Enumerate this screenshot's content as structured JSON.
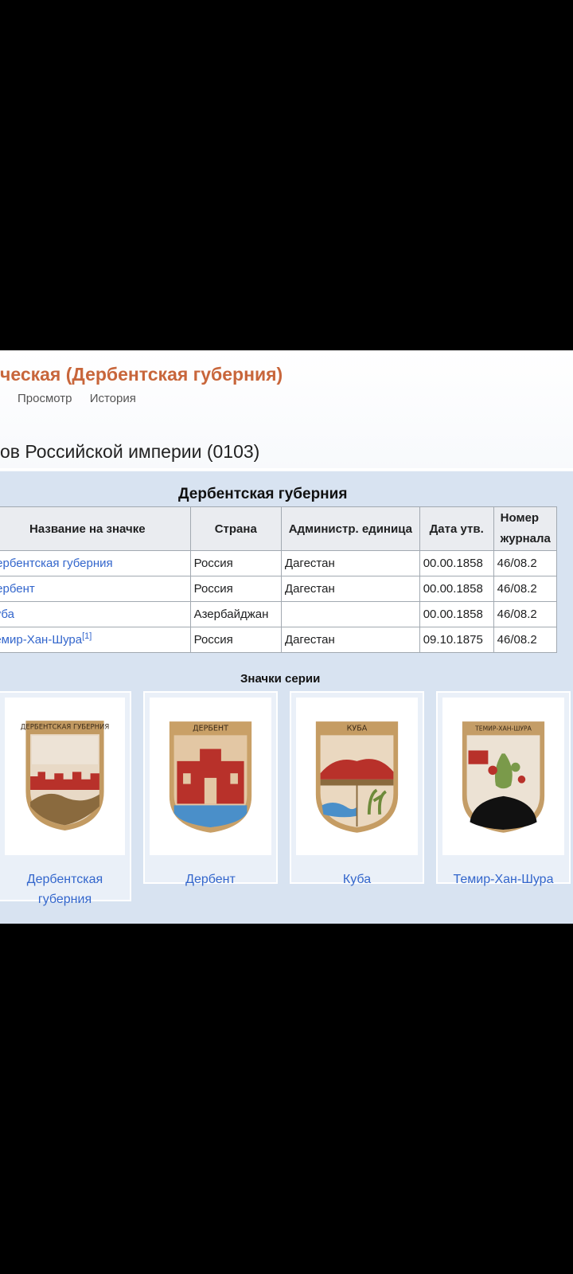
{
  "page": {
    "title": "ческая (Дербентская губерния)",
    "tabs": [
      "Просмотр",
      "История"
    ],
    "section_heading": "ов Российской империи (0103)"
  },
  "table": {
    "caption": "Дербентская губерния",
    "headers": [
      "Название на значке",
      "Страна",
      "Администр. единица",
      "Дата утв.",
      "Номер журнала"
    ],
    "rows": [
      {
        "name": "Дербентская губерния",
        "country": "Россия",
        "admin": "Дагестан",
        "date": "00.00.1858",
        "journal": "46/08.2"
      },
      {
        "name": "Дербент",
        "country": "Россия",
        "admin": "Дагестан",
        "date": "00.00.1858",
        "journal": "46/08.2"
      },
      {
        "name": "Куба",
        "country": "Азербайджан",
        "admin": "",
        "date": "00.00.1858",
        "journal": "46/08.2"
      },
      {
        "name": "Темир-Хан-Шура",
        "note": "[1]",
        "country": "Россия",
        "admin": "Дагестан",
        "date": "09.10.1875",
        "journal": "46/08.2"
      }
    ]
  },
  "gallery": {
    "caption": "Значки серии",
    "items": [
      {
        "caption": "Дербентская губерния",
        "badge_text": "ДЕРБЕНТСКАЯ ГУБЕРНИЯ"
      },
      {
        "caption": "Дербент",
        "badge_text": "ДЕРБЕНТ"
      },
      {
        "caption": "Куба",
        "badge_text": "КУБА"
      },
      {
        "caption": "Темир-Хан-Шура",
        "badge_text": "ТЕМИР-ХАН-ШУРА"
      }
    ]
  },
  "colors": {
    "title": "#c8663b",
    "link": "#3366cc",
    "panel": "#d8e3f1",
    "table_header": "#eaecf0",
    "badge_gold": "#b98a45",
    "badge_red": "#b8312a",
    "badge_blue": "#4a8fc9",
    "badge_black": "#111111"
  }
}
